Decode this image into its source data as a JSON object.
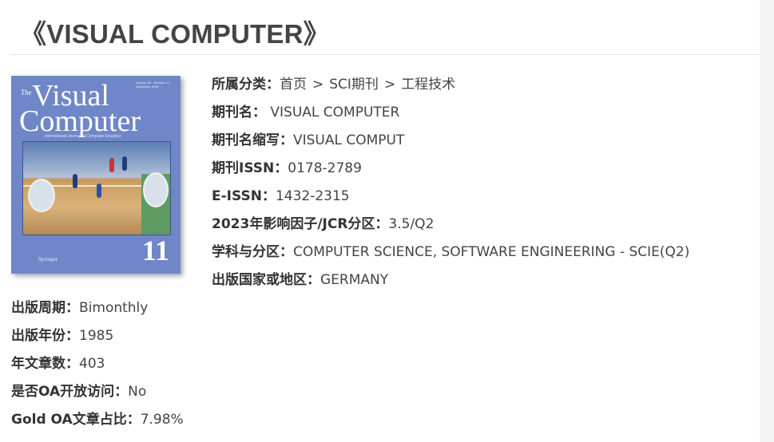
{
  "page_title": "《VISUAL COMPUTER》",
  "cover": {
    "volume_text": "Volume 35 · Number 11 · November 2019",
    "title_the": "The",
    "title_line1": "Visual",
    "title_line2": "Computer",
    "subtitle": "International Journal of Computer Graphics",
    "issue_number": "11",
    "publisher": "Springer",
    "background_color": "#6f86c8"
  },
  "breadcrumb": {
    "label": "所属分类：",
    "items": [
      "首页",
      "SCI期刊",
      "工程技术"
    ],
    "separator": ">"
  },
  "details": [
    {
      "label": "期刊名：",
      "value": "VISUAL COMPUTER"
    },
    {
      "label": "期刊名缩写：",
      "value": "VISUAL COMPUT"
    },
    {
      "label": "期刊ISSN：",
      "value": "0178-2789"
    },
    {
      "label": "E-ISSN：",
      "value": "1432-2315"
    },
    {
      "label": "2023年影响因子/JCR分区：",
      "value": "3.5/Q2"
    },
    {
      "label": "学科与分区：",
      "value": "COMPUTER SCIENCE, SOFTWARE ENGINEERING - SCIE(Q2)"
    },
    {
      "label": "出版国家或地区：",
      "value": "GERMANY"
    }
  ],
  "left_details": [
    {
      "label": "出版周期：",
      "value": "Bimonthly"
    },
    {
      "label": "出版年份：",
      "value": "1985"
    },
    {
      "label": "年文章数：",
      "value": "403"
    },
    {
      "label": "是否OA开放访问：",
      "value": "No"
    },
    {
      "label": "Gold OA文章占比：",
      "value": "7.98%"
    }
  ]
}
